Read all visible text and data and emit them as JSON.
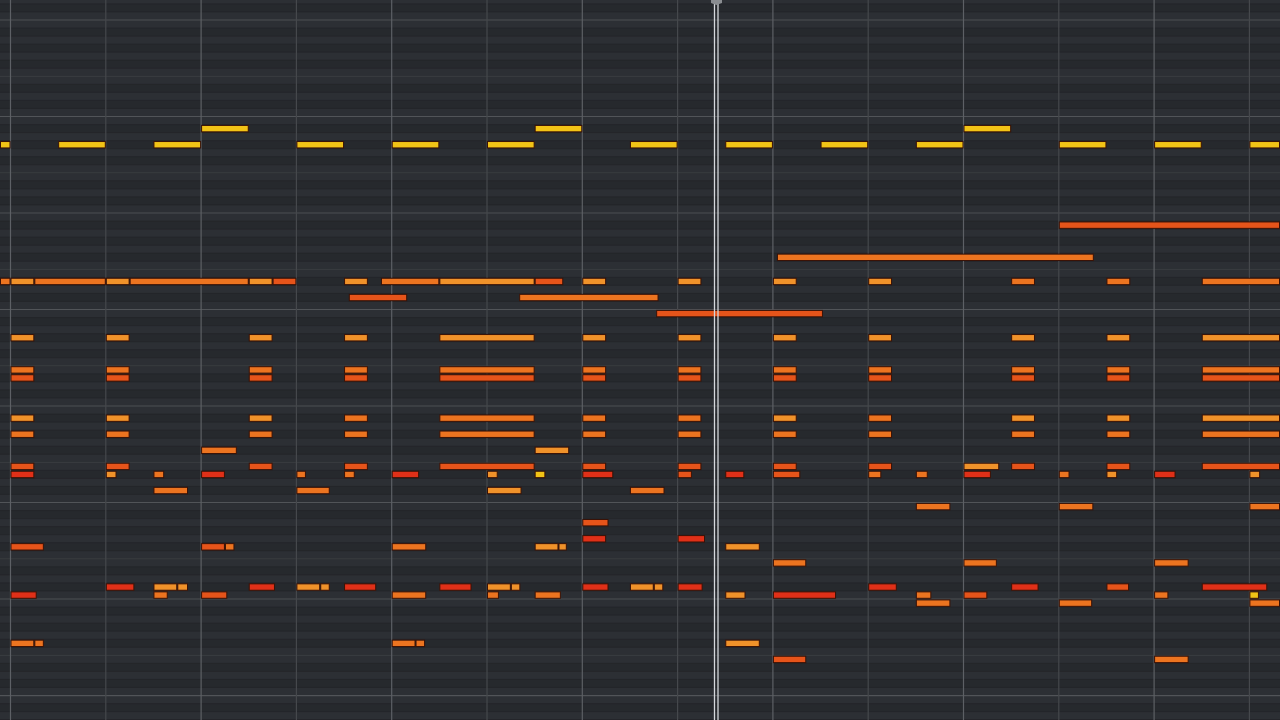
{
  "piano_roll": {
    "note_colors": [
      {
        "color": "#f2c316"
      },
      {
        "color": "#f0922a"
      },
      {
        "color": "#ec7420"
      },
      {
        "color": "#e6541a"
      },
      {
        "color": "#e03018"
      }
    ]
  }
}
